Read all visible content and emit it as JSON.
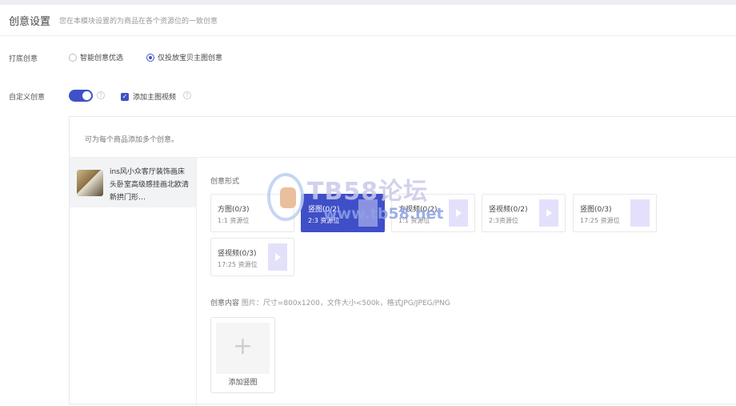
{
  "header": {
    "title": "创意设置",
    "subtitle": "您在本模块设置的为商品在各个资源位的一致创意"
  },
  "base_creative": {
    "label": "打底创意",
    "options": [
      {
        "label": "智能创意优选",
        "selected": false
      },
      {
        "label": "仅投放宝贝主图创意",
        "selected": true
      }
    ]
  },
  "custom_creative": {
    "label": "自定义创意",
    "toggle_on": true,
    "help_icon": "question-circle-icon",
    "checkbox_label": "添加主图视频",
    "checkbox_checked": true
  },
  "panel": {
    "tip": "可为每个商品添加多个创意。",
    "product_title": "ins风小众客厅装饰画床头卧室高级感挂画北欧清新拱门形…",
    "format_label": "创意形式",
    "formats": [
      {
        "name": "方图(0/3)",
        "ratio": "1:1 资源位",
        "thumb": "none",
        "selected": false
      },
      {
        "name": "竖图(0/2)",
        "ratio": "2:3 资源位",
        "thumb": "image",
        "selected": true
      },
      {
        "name": "方视频(0/2)",
        "ratio": "1:1 资源位",
        "thumb": "video",
        "selected": false
      },
      {
        "name": "竖视频(0/2)",
        "ratio": "2:3资源位",
        "thumb": "video",
        "selected": false
      },
      {
        "name": "竖图(0/3)",
        "ratio": "17:25 资源位",
        "thumb": "image",
        "selected": false
      },
      {
        "name": "竖视频(0/3)",
        "ratio": "17:25 资源位",
        "thumb": "video",
        "selected": false
      }
    ],
    "content_label": "创意内容",
    "content_spec": "图片：尺寸=800x1200，文件大小<500k，格式JPG/JPEG/PNG",
    "upload_label": "添加竖图",
    "upload_icon": "plus-icon"
  },
  "watermark": {
    "text": "TB58论坛",
    "url": "www.tb58.net"
  },
  "colors": {
    "accent": "#3f51c6",
    "thumb_bg": "#e3e0fb"
  }
}
